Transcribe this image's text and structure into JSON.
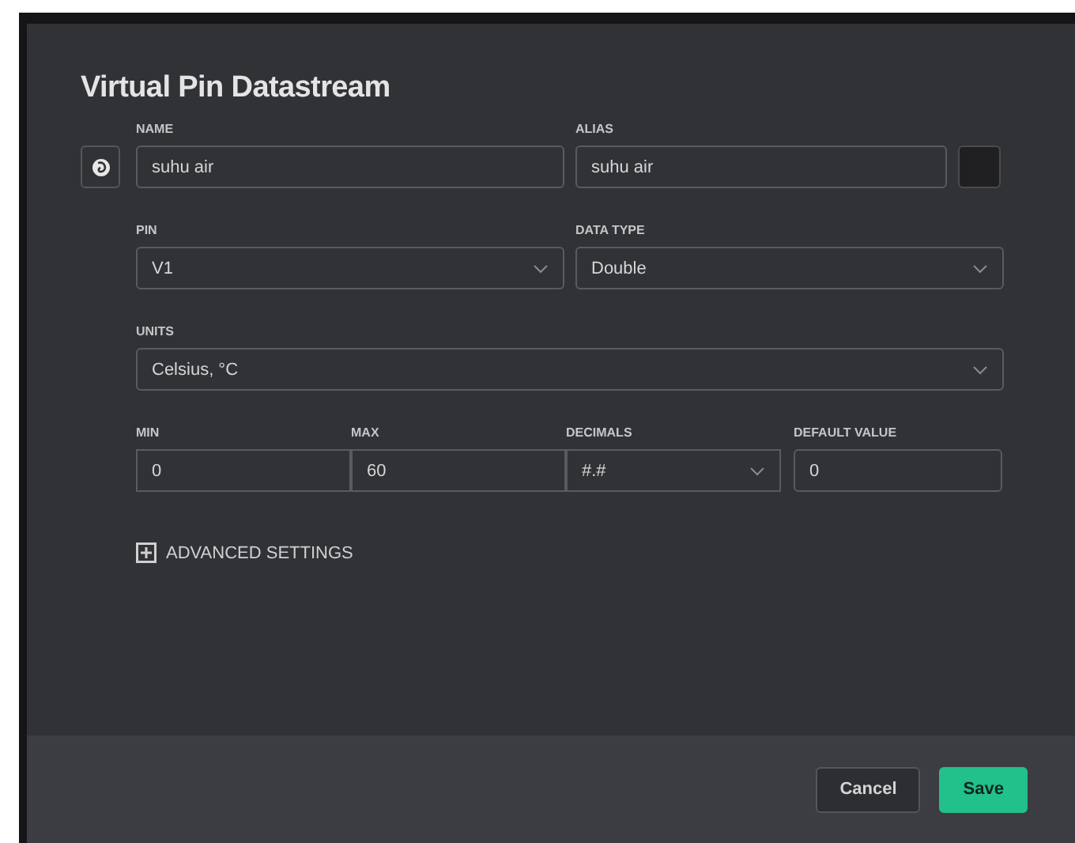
{
  "dialog": {
    "title": "Virtual Pin Datastream",
    "name": {
      "label": "NAME",
      "value": "suhu air"
    },
    "alias": {
      "label": "ALIAS",
      "value": "suhu air"
    },
    "pin": {
      "label": "PIN",
      "value": "V1"
    },
    "data_type": {
      "label": "DATA TYPE",
      "value": "Double"
    },
    "units": {
      "label": "UNITS",
      "value": "Celsius, °C"
    },
    "min": {
      "label": "MIN",
      "value": "0"
    },
    "max": {
      "label": "MAX",
      "value": "60"
    },
    "decimals": {
      "label": "DECIMALS",
      "value": "#.#"
    },
    "default_value": {
      "label": "DEFAULT VALUE",
      "value": "0"
    },
    "advanced": {
      "label": "ADVANCED SETTINGS",
      "expanded": false
    },
    "buttons": [
      {
        "label": "Cancel",
        "kind": "secondary"
      },
      {
        "label": "Save",
        "kind": "primary"
      }
    ]
  }
}
